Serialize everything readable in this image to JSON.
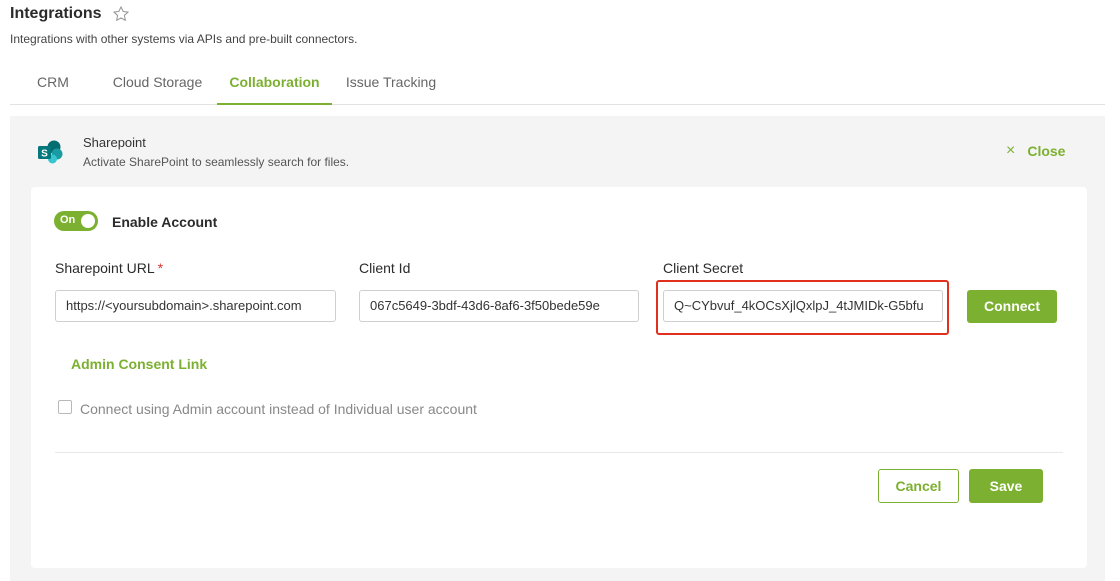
{
  "header": {
    "title": "Integrations",
    "subtitle": "Integrations with other systems via APIs and pre-built connectors."
  },
  "tabs": [
    {
      "label": "CRM",
      "active": false
    },
    {
      "label": "Cloud Storage",
      "active": false
    },
    {
      "label": "Collaboration",
      "active": true
    },
    {
      "label": "Issue Tracking",
      "active": false
    }
  ],
  "integration": {
    "name": "Sharepoint",
    "description": "Activate SharePoint to seamlessly search for files.",
    "close_label": "Close",
    "close_icon": "×"
  },
  "form": {
    "toggle_label": "On",
    "enable_label": "Enable Account",
    "sharepoint_url": {
      "label": "Sharepoint URL",
      "required_mark": "*",
      "value": "https://<yoursubdomain>.sharepoint.com"
    },
    "client_id": {
      "label": "Client Id",
      "value": "067c5649-3bdf-43d6-8af6-3f50bede59e"
    },
    "client_secret": {
      "label": "Client Secret",
      "value": "Q~CYbvuf_4kOCsXjlQxlpJ_4tJMIDk-G5bfu"
    },
    "connect_label": "Connect",
    "admin_consent_link": "Admin Consent Link",
    "admin_checkbox_label": "Connect using Admin account instead of Individual user account",
    "admin_checkbox_checked": false,
    "cancel_label": "Cancel",
    "save_label": "Save"
  },
  "colors": {
    "accent": "#7cb030",
    "highlight": "#e0301e",
    "sharepoint_teal": "#038387"
  }
}
